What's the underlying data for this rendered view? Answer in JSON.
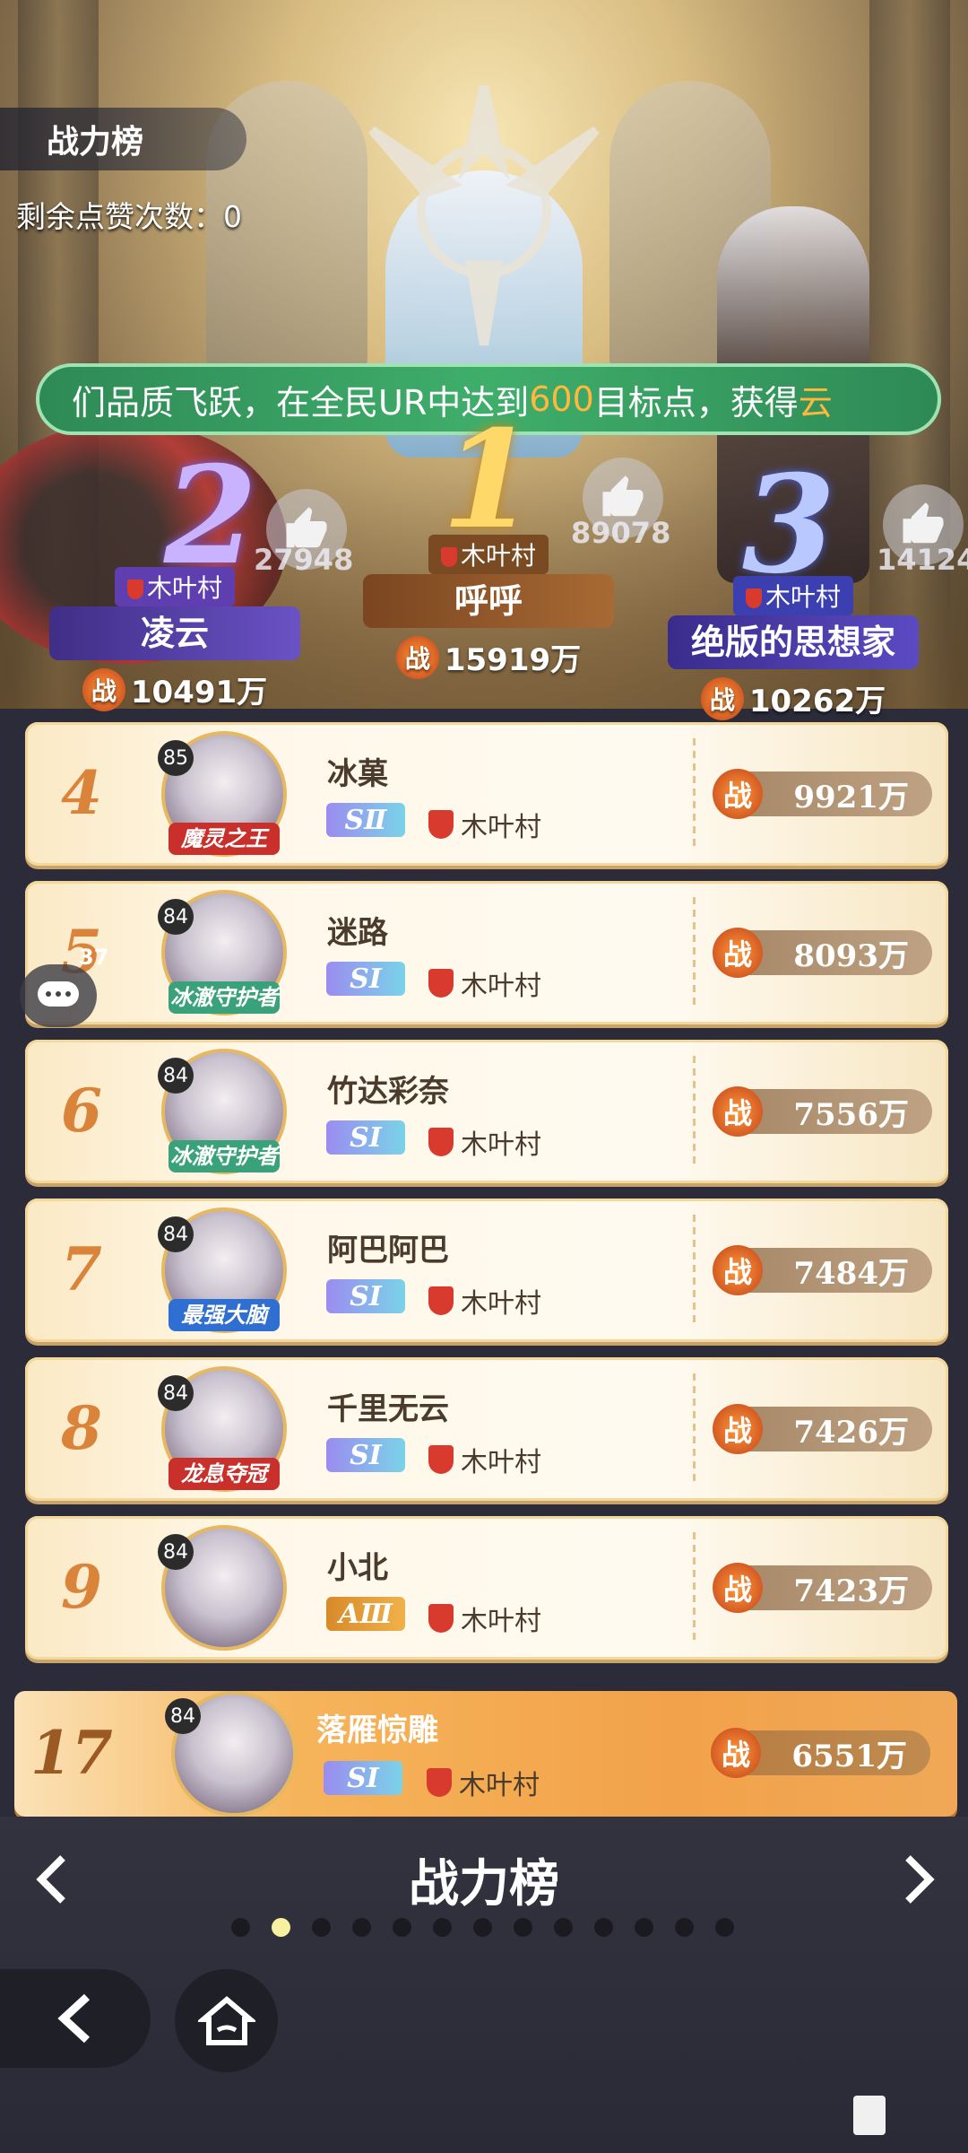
{
  "header": {
    "tab_label": "战力榜",
    "likes_remaining": "剩余点赞次数：0"
  },
  "marquee": {
    "text_before": "们品质飞跃，在全民UR中达到",
    "highlight_number": "600",
    "text_middle": "目标点，获得",
    "highlight_tail": "云"
  },
  "podium": [
    {
      "rank": "2",
      "guild": "木叶村",
      "name": "凌云",
      "power": "10491万",
      "likes": "27948"
    },
    {
      "rank": "1",
      "guild": "木叶村",
      "name": "呼呼",
      "power": "15919万",
      "likes": "89078"
    },
    {
      "rank": "3",
      "guild": "木叶村",
      "name": "绝版的思想家",
      "power": "10262万",
      "likes": "14124"
    }
  ],
  "power_badge": "战",
  "rows": [
    {
      "rank": "4",
      "level": "85",
      "title": "魔灵之王",
      "name": "冰菓",
      "tier": "SⅡ",
      "guild": "木叶村",
      "power": "9921万",
      "tier_color": "#9b8cf0",
      "title_color": "#c9302c"
    },
    {
      "rank": "5",
      "level": "84",
      "title": "冰澈守护者",
      "name": "迷路",
      "tier": "SⅠ",
      "guild": "木叶村",
      "power": "8093万",
      "tier_color": "#9b8cf0",
      "title_color": "#3aa27a"
    },
    {
      "rank": "6",
      "level": "84",
      "title": "冰澈守护者",
      "name": "竹达彩奈",
      "tier": "SⅠ",
      "guild": "木叶村",
      "power": "7556万",
      "tier_color": "#9b8cf0",
      "title_color": "#3aa27a"
    },
    {
      "rank": "7",
      "level": "84",
      "title": "最强大脑",
      "name": "阿巴阿巴",
      "tier": "SⅠ",
      "guild": "木叶村",
      "power": "7484万",
      "tier_color": "#9b8cf0",
      "title_color": "#2f6fd1"
    },
    {
      "rank": "8",
      "level": "84",
      "title": "龙息夺冠",
      "name": "千里无云",
      "tier": "SⅠ",
      "guild": "木叶村",
      "power": "7426万",
      "tier_color": "#9b8cf0",
      "title_color": "#c9302c"
    },
    {
      "rank": "9",
      "level": "84",
      "title": "",
      "name": "小北",
      "tier": "AⅢ",
      "guild": "木叶村",
      "power": "7423万",
      "tier_color": "#e0922f",
      "title_color": "#c9302c"
    }
  ],
  "my_rank": {
    "rank": "17",
    "level": "84",
    "name": "落雁惊雕",
    "tier": "SⅠ",
    "guild": "木叶村",
    "power": "6551万"
  },
  "chat_badge": "37",
  "footer": {
    "board_title": "战力榜",
    "page_count": 13,
    "active_page": 2
  }
}
